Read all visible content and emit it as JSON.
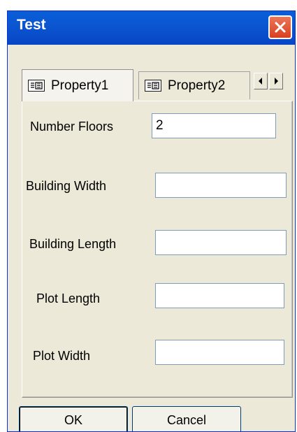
{
  "window": {
    "title": "Test"
  },
  "tabs": [
    {
      "label": "Property1",
      "icon": "form-icon",
      "active": true
    },
    {
      "label": "Property2",
      "icon": "form-icon",
      "active": false
    }
  ],
  "fields": {
    "number_floors": {
      "label": "Number Floors",
      "value": "2"
    },
    "building_width": {
      "label": "Building Width",
      "value": ""
    },
    "building_length": {
      "label": "Building Length",
      "value": ""
    },
    "plot_length": {
      "label": "Plot Length",
      "value": ""
    },
    "plot_width": {
      "label": "Plot Width",
      "value": ""
    }
  },
  "buttons": {
    "ok": "OK",
    "cancel": "Cancel"
  },
  "colors": {
    "titlebar": "#0a5ed8",
    "dialog_bg": "#ece9d8",
    "close": "#d9411f"
  }
}
